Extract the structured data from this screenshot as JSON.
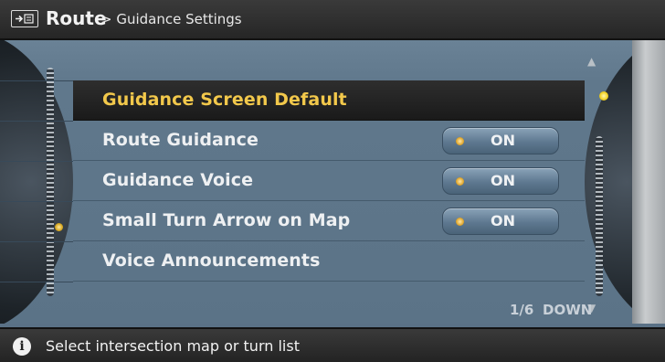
{
  "header": {
    "title": "Route",
    "breadcrumb": "> Guidance Settings",
    "icon": "route-icon"
  },
  "menu": {
    "items": [
      {
        "label": "Guidance Screen Default",
        "selected": true
      },
      {
        "label": "Route Guidance",
        "toggle": "ON"
      },
      {
        "label": "Guidance Voice",
        "toggle": "ON"
      },
      {
        "label": "Small Turn Arrow on Map",
        "toggle": "ON"
      },
      {
        "label": "Voice Announcements"
      }
    ]
  },
  "pager": {
    "page": "1/6",
    "direction": "DOWN"
  },
  "status": {
    "icon": "info-icon",
    "text": "Select intersection map or turn list"
  },
  "colors": {
    "selected_text": "#f2c84b",
    "panel": "#5b7387"
  }
}
